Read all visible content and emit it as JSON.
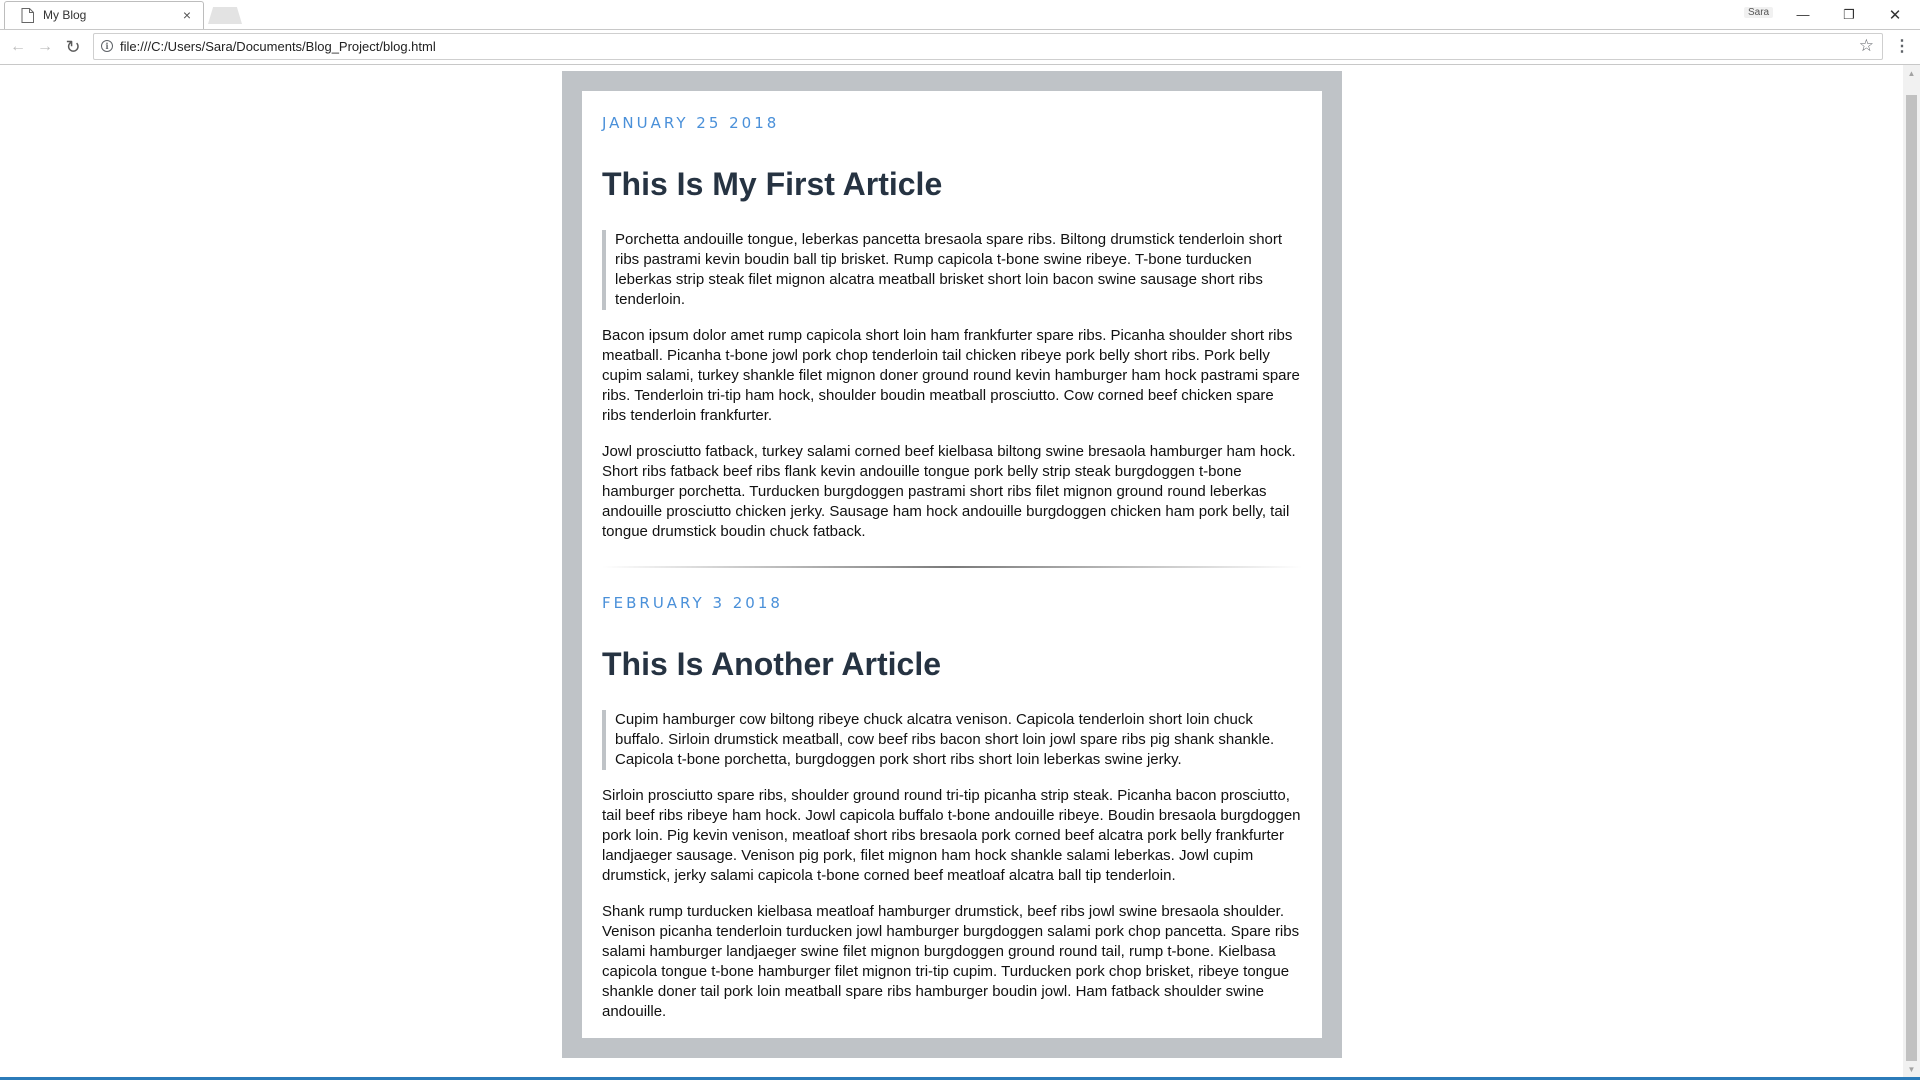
{
  "browser": {
    "tab_title": "My Blog",
    "tab_close": "×",
    "profile_name": "Sara",
    "url": "file:///C:/Users/Sara/Documents/Blog_Project/blog.html",
    "back_icon": "←",
    "forward_icon": "→",
    "reload_icon": "↻",
    "info_icon": "i",
    "star_icon": "☆",
    "menu_icon": "⋮",
    "minimize_icon": "—",
    "maximize_icon": "❐",
    "close_icon": "✕"
  },
  "articles": [
    {
      "date": "JANUARY 25 2018",
      "title": "This Is My First Article",
      "quote": "Porchetta andouille tongue, leberkas pancetta bresaola spare ribs. Biltong drumstick tenderloin short ribs pastrami kevin boudin ball tip brisket. Rump capicola t-bone swine ribeye. T-bone turducken leberkas strip steak filet mignon alcatra meatball brisket short loin bacon swine sausage short ribs tenderloin.",
      "paragraphs": [
        "Bacon ipsum dolor amet rump capicola short loin ham frankfurter spare ribs. Picanha shoulder short ribs meatball. Picanha t-bone jowl pork chop tenderloin tail chicken ribeye pork belly short ribs. Pork belly cupim salami, turkey shankle filet mignon doner ground round kevin hamburger ham hock pastrami spare ribs. Tenderloin tri-tip ham hock, shoulder boudin meatball prosciutto. Cow corned beef chicken spare ribs tenderloin frankfurter.",
        "Jowl prosciutto fatback, turkey salami corned beef kielbasa biltong swine bresaola hamburger ham hock. Short ribs fatback beef ribs flank kevin andouille tongue pork belly strip steak burgdoggen t-bone hamburger porchetta. Turducken burgdoggen pastrami short ribs filet mignon ground round leberkas andouille prosciutto chicken jerky. Sausage ham hock andouille burgdoggen chicken ham pork belly, tail tongue drumstick boudin chuck fatback."
      ]
    },
    {
      "date": "FEBRUARY 3 2018",
      "title": "This Is Another Article",
      "quote": "Cupim hamburger cow biltong ribeye chuck alcatra venison. Capicola tenderloin short loin chuck buffalo. Sirloin drumstick meatball, cow beef ribs bacon short loin jowl spare ribs pig shank shankle. Capicola t-bone porchetta, burgdoggen pork short ribs short loin leberkas swine jerky.",
      "paragraphs": [
        "Sirloin prosciutto spare ribs, shoulder ground round tri-tip picanha strip steak. Picanha bacon prosciutto, tail beef ribs ribeye ham hock. Jowl capicola buffalo t-bone andouille ribeye. Boudin bresaola burgdoggen pork loin. Pig kevin venison, meatloaf short ribs bresaola pork corned beef alcatra pork belly frankfurter landjaeger sausage. Venison pig pork, filet mignon ham hock shankle salami leberkas. Jowl cupim drumstick, jerky salami capicola t-bone corned beef meatloaf alcatra ball tip tenderloin.",
        "Shank rump turducken kielbasa meatloaf hamburger drumstick, beef ribs jowl swine bresaola shoulder. Venison picanha tenderloin turducken jowl hamburger burgdoggen salami pork chop pancetta. Spare ribs salami hamburger landjaeger swine filet mignon burgdoggen ground round tail, rump t-bone. Kielbasa capicola tongue t-bone hamburger filet mignon tri-tip cupim. Turducken pork chop brisket, ribeye tongue shankle doner tail pork loin meatball spare ribs hamburger boudin jowl. Ham fatback shoulder swine andouille."
      ]
    }
  ],
  "colors": {
    "date_accent": "#4a90d9",
    "title": "#263342",
    "frame": "#bfc3c7"
  }
}
